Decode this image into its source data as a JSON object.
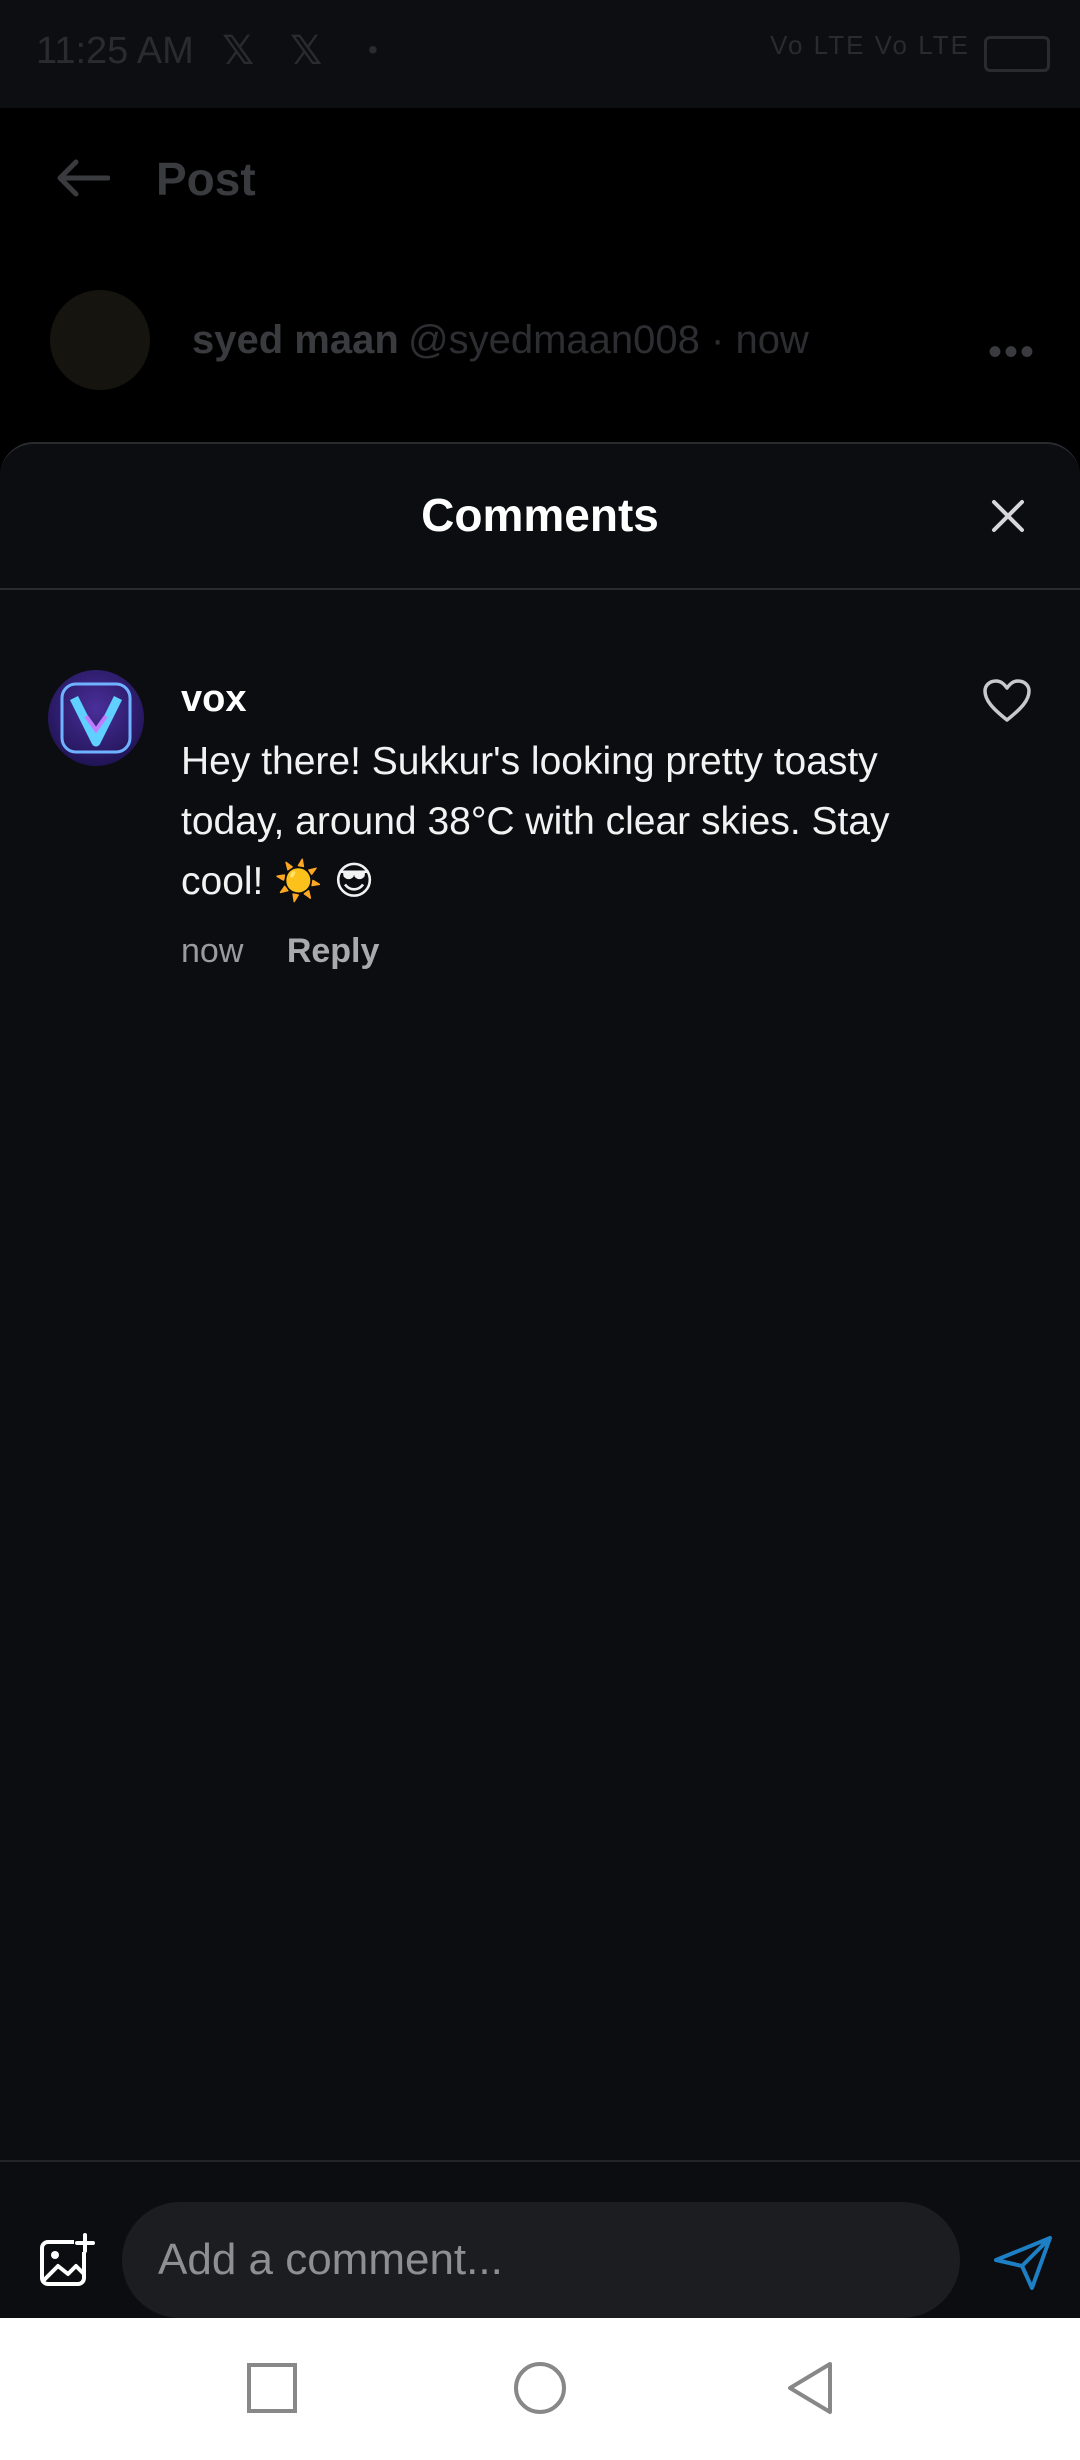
{
  "status_bar": {
    "time": "11:25 AM",
    "indicators": "Vo LTE Vo LTE"
  },
  "post_header": {
    "title": "Post",
    "back_icon": "arrow-left-icon"
  },
  "post_author": {
    "name": "syed maan",
    "handle_time": "@syedmaan008 · now",
    "more_icon": "more-horizontal-icon"
  },
  "comments_sheet": {
    "title": "Comments",
    "close_icon": "close-icon",
    "comments": [
      {
        "author": "vox",
        "text": "Hey there! Sukkur's looking pretty toasty today, around 38°C with clear skies. Stay cool! ☀️ 😎",
        "time": "now",
        "reply_label": "Reply",
        "like_icon": "heart-icon"
      }
    ]
  },
  "composer": {
    "placeholder": "Add a comment...",
    "image_icon": "add-image-icon",
    "send_icon": "send-icon",
    "accent_color": "#1d9bf0"
  },
  "nav_bar": {
    "recents_icon": "square-icon",
    "home_icon": "circle-icon",
    "back_icon": "triangle-back-icon"
  }
}
